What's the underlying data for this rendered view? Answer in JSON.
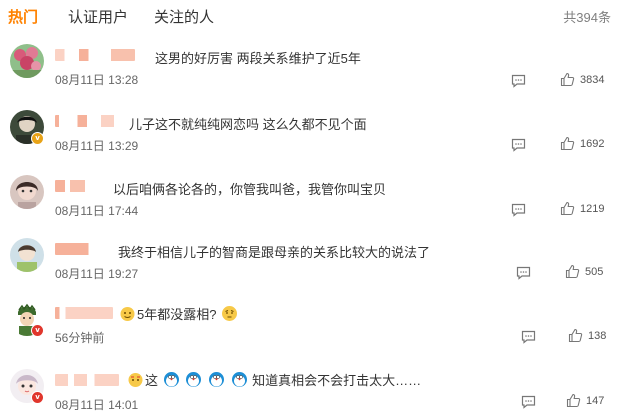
{
  "tabs": [
    {
      "label": "热门",
      "active": true
    },
    {
      "label": "认证用户",
      "active": false
    },
    {
      "label": "关注的人",
      "active": false
    }
  ],
  "total_label": "共394条",
  "colors": {
    "accent": "#ff8200",
    "muted": "#808080",
    "name_blur": "#f6b19a"
  },
  "comments": [
    {
      "text": "这男的好厉害 两段关系维护了近5年",
      "time": "08月11日 13:28",
      "likes": "3834",
      "badge": ""
    },
    {
      "text": "儿子这不就纯纯网恋吗 这么久都不见个面",
      "time": "08月11日 13:29",
      "likes": "1692",
      "badge": "yellow"
    },
    {
      "text": "以后咱俩各论各的，你管我叫爸，我管你叫宝贝",
      "time": "08月11日 17:44",
      "likes": "1219",
      "badge": ""
    },
    {
      "text": "我终于相信儿子的智商是跟母亲的关系比较大的说法了",
      "time": "08月11日 19:27",
      "likes": "505",
      "badge": ""
    },
    {
      "text": "5年都没露相?",
      "time": "56分钟前",
      "likes": "138",
      "badge": "red"
    },
    {
      "text_prefix": "这",
      "text": "知道真相会不会打击太大……",
      "time": "08月11日 14:01",
      "likes": "147",
      "badge": "red"
    }
  ]
}
